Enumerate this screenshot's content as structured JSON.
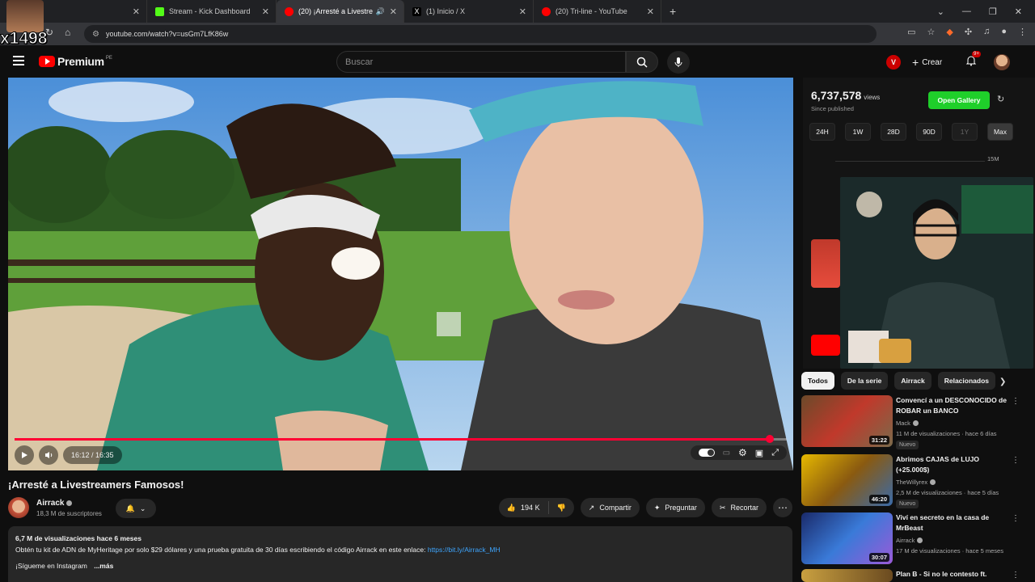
{
  "browser": {
    "tabs": [
      {
        "label": "ck",
        "favicon_color": "#8b5a3c",
        "active": false
      },
      {
        "label": "Stream - Kick Dashboard",
        "favicon_color": "#53fc18",
        "active": false
      },
      {
        "label": "(20) ¡Arresté a Livestream",
        "favicon_color": "#ff0000",
        "active": true
      },
      {
        "label": "(1) Inicio / X",
        "favicon_color": "#ffffff",
        "active": false
      },
      {
        "label": "(20) Tri-line - YouTube",
        "favicon_color": "#ff0000",
        "active": false
      }
    ],
    "new_tab": "+",
    "url": "youtube.com/watch?v=usGm7LfK86w"
  },
  "overlay": {
    "tag": "x1498"
  },
  "youtube": {
    "logo_text": "Premium",
    "logo_country": "PE",
    "search_placeholder": "Buscar",
    "create_label": "Crear",
    "notif_count": "9+",
    "avatar_letter": "V"
  },
  "player": {
    "time": "16:12 / 16:35",
    "progress": 0.978
  },
  "video": {
    "title": "¡Arresté a Livestreamers Famosos!",
    "channel": "Airrack",
    "subscribers": "18,3 M de suscriptores",
    "likes": "194 K",
    "share": "Compartir",
    "ask": "Preguntar",
    "clip": "Recortar",
    "desc_meta": "6,7 M de visualizaciones  hace 6 meses",
    "desc_line": "Obtén tu kit de ADN de MyHeritage por solo $29 dólares y una prueba gratuita de 30 días escribiendo el código Airrack en este enlace: ",
    "desc_link": "https://bit.ly/Airrack_MH",
    "desc_line2": "¡Sígueme en Instagram",
    "desc_more": "...más"
  },
  "stats": {
    "views": "6,737,578",
    "views_unit": "views",
    "since": "Since published",
    "gallery": "Open Gallery",
    "ranges": [
      "24H",
      "1W",
      "28D",
      "90D",
      "1Y",
      "Max"
    ],
    "selected_range": "Max",
    "ymax": "15M"
  },
  "chips": [
    "Todos",
    "De la serie",
    "Airrack",
    "Relacionados"
  ],
  "recommendations": [
    {
      "title": "Convencí a un DESCONOCIDO de ROBAR un BANCO",
      "channel": "Mack",
      "meta": "11 M de visualizaciones · hace 6 días",
      "duration": "31:22",
      "badge": "Nuevo"
    },
    {
      "title": "Abrimos CAJAS de LUJO (+25.000$)",
      "channel": "TheWillyrex",
      "meta": "2,5 M de visualizaciones · hace 5 días",
      "duration": "46:20",
      "badge": "Nuevo"
    },
    {
      "title": "Viví en secreto en la casa de MrBeast",
      "channel": "Airrack",
      "meta": "17 M de visualizaciones · hace 5 meses",
      "duration": "30:07",
      "badge": ""
    },
    {
      "title": "Plan B - Si no le contesto ft.",
      "channel": "",
      "meta": "",
      "duration": "",
      "badge": ""
    }
  ]
}
